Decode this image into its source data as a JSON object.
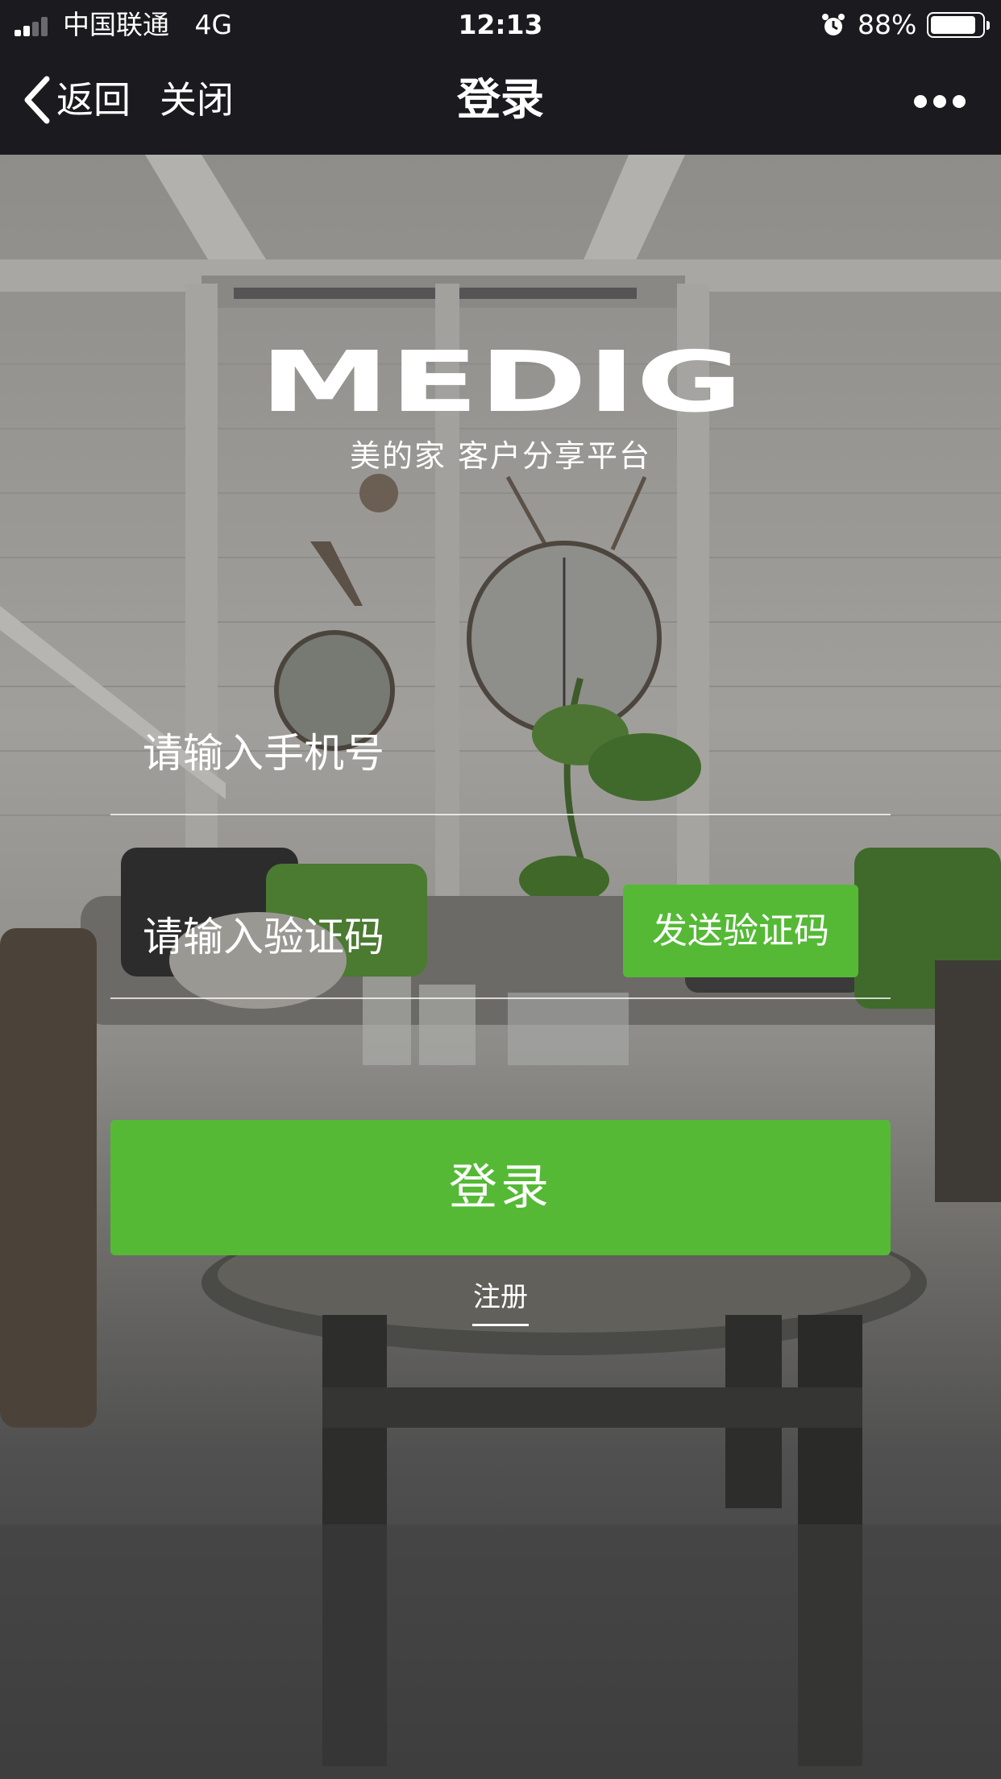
{
  "status_bar": {
    "carrier": "中国联通",
    "network": "4G",
    "time": "12:13",
    "battery": "88%",
    "battery_level": 0.88,
    "signal_bars": 2,
    "icons": [
      "signal-icon",
      "alarm-icon",
      "battery-icon"
    ]
  },
  "nav": {
    "back_label": "返回",
    "close_label": "关闭",
    "title": "登录",
    "more_icon": "more-dots-icon"
  },
  "brand": {
    "logo_text": "MEDIG",
    "subtitle": "美的家  客户分享平台"
  },
  "form": {
    "phone_placeholder": "请输入手机号",
    "phone_value": "",
    "code_placeholder": "请输入验证码",
    "code_value": "",
    "send_code_label": "发送验证码",
    "login_label": "登录",
    "register_label": "注册"
  },
  "colors": {
    "accent": "#55b936",
    "topbar": "#1b1b1f"
  }
}
